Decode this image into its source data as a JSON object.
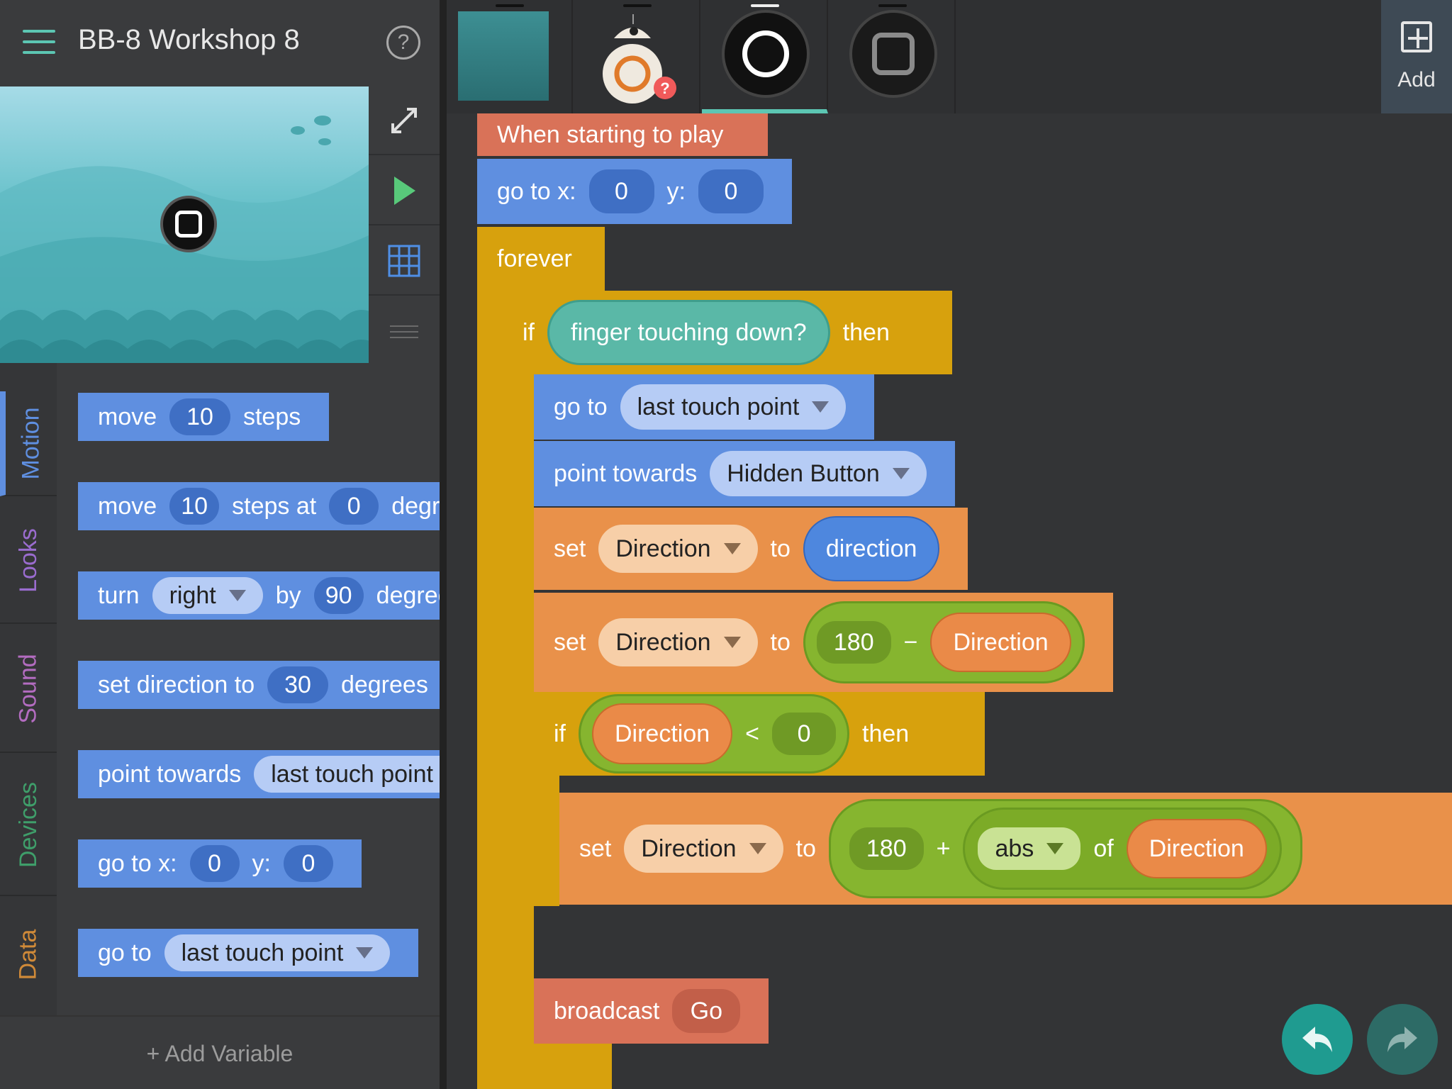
{
  "header": {
    "title": "BB-8 Workshop 8",
    "help": "?"
  },
  "categories": [
    {
      "label": "Motion",
      "color": "#5f8fe0"
    },
    {
      "label": "Looks",
      "color": "#9a6ccf"
    },
    {
      "label": "Sound",
      "color": "#b36cc0"
    },
    {
      "label": "Devices",
      "color": "#3f9e6a"
    },
    {
      "label": "Data",
      "color": "#d08a38"
    }
  ],
  "palette": {
    "b1": {
      "w1": "move",
      "n1": "10",
      "w2": "steps"
    },
    "b2": {
      "w1": "move",
      "n1": "10",
      "w2": "steps at",
      "n2": "0",
      "w3": "degre"
    },
    "b3": {
      "w1": "turn",
      "d1": "right",
      "w2": "by",
      "n1": "90",
      "w3": "degree"
    },
    "b4": {
      "w1": "set direction to",
      "n1": "30",
      "w2": "degrees"
    },
    "b5": {
      "w1": "point towards",
      "d1": "last touch point"
    },
    "b6": {
      "w1": "go to x:",
      "n1": "0",
      "w2": "y:",
      "n2": "0"
    },
    "b7": {
      "w1": "go to",
      "d1": "last touch point"
    }
  },
  "add_variable": "+ Add Variable",
  "add_button": {
    "label": "Add"
  },
  "script": {
    "hat": "When starting to play",
    "goto": {
      "w1": "go to x:",
      "x": "0",
      "w2": "y:",
      "y": "0"
    },
    "forever": "forever",
    "if1": {
      "w1": "if",
      "cond": "finger touching down?",
      "w2": "then"
    },
    "goto2": {
      "w1": "go to",
      "target": "last touch point"
    },
    "point": {
      "w1": "point towards",
      "target": "Hidden Button"
    },
    "set1": {
      "w1": "set",
      "var": "Direction",
      "w2": "to",
      "val": "direction"
    },
    "set2": {
      "w1": "set",
      "var": "Direction",
      "w2": "to",
      "n": "180",
      "op": "−",
      "v": "Direction"
    },
    "if2": {
      "w1": "if",
      "v": "Direction",
      "op": "<",
      "n": "0",
      "w2": "then"
    },
    "set3": {
      "w1": "set",
      "var": "Direction",
      "w2": "to",
      "n": "180",
      "op": "+",
      "fn": "abs",
      "of": "of",
      "v": "Direction"
    },
    "broadcast": {
      "w1": "broadcast",
      "msg": "Go"
    }
  },
  "colors": {
    "motion": "#5f8fe0",
    "control": "#d7a10d",
    "data": "#e9914a",
    "event": "#d97258",
    "operator": "#86b52f",
    "accent": "#5cc6b3"
  }
}
